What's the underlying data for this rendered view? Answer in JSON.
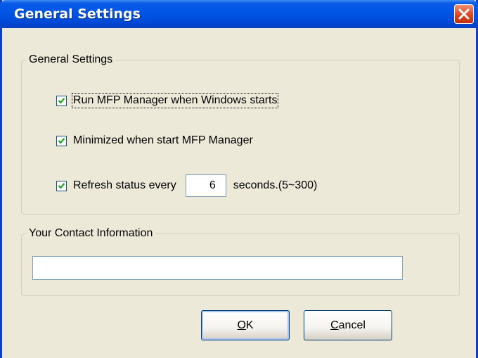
{
  "window": {
    "title": "General Settings"
  },
  "general_group": {
    "legend": "General Settings",
    "options": [
      {
        "label": "Run MFP Manager when Windows starts",
        "checked": true
      },
      {
        "label": "Minimized when start MFP Manager",
        "checked": true
      },
      {
        "label": "Refresh status every",
        "checked": true
      }
    ],
    "refresh_value": "6",
    "refresh_suffix": "seconds.(5~300)"
  },
  "contact_group": {
    "legend": "Your Contact Information",
    "value": ""
  },
  "buttons": {
    "ok_first": "O",
    "ok_rest": "K",
    "cancel_first": "C",
    "cancel_rest": "ancel"
  },
  "icons": {
    "close": "close-icon",
    "checkbox": "checkmark-icon"
  },
  "colors": {
    "titlebar": "#0055e5",
    "dialog_bg": "#ece9d8",
    "close_button": "#d8421d"
  }
}
